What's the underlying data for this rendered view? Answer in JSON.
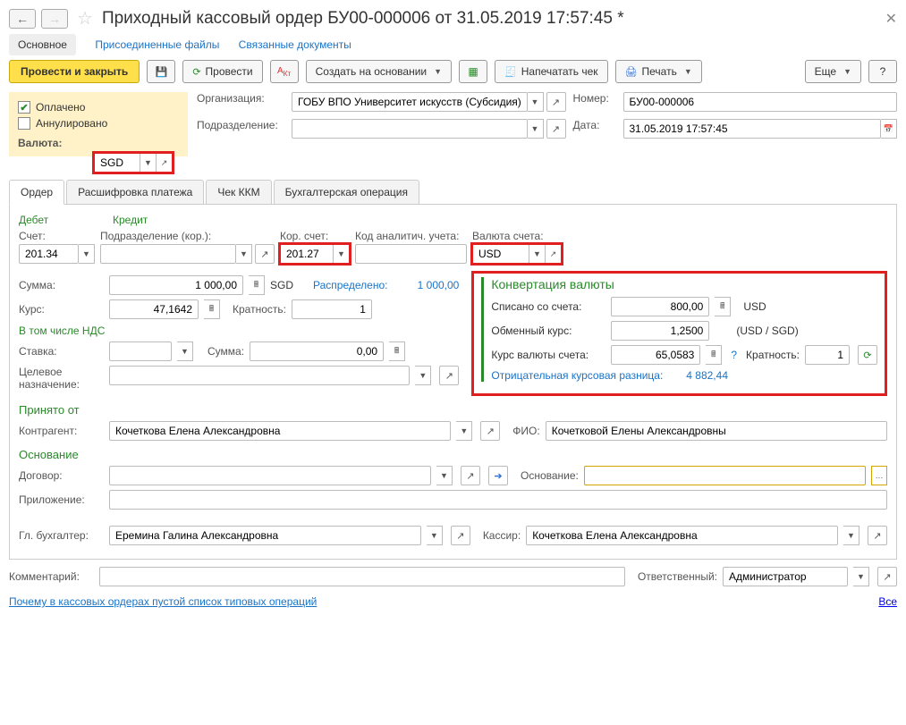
{
  "title": "Приходный кассовый ордер БУ00-000006 от 31.05.2019 17:57:45 *",
  "subnav": {
    "main": "Основное",
    "files": "Присоединенные файлы",
    "linked": "Связанные документы"
  },
  "toolbar": {
    "postClose": "Провести и закрыть",
    "post": "Провести",
    "createBased": "Создать на основании",
    "printReceipt": "Напечатать чек",
    "print": "Печать",
    "more": "Еще",
    "help": "?"
  },
  "status": {
    "paid": "Оплачено",
    "cancelled": "Аннулировано"
  },
  "header": {
    "orgLabel": "Организация:",
    "org": "ГОБУ ВПО Университет искусств (Субсидия)",
    "numLabel": "Номер:",
    "num": "БУ00-000006",
    "depLabel": "Подразделение:",
    "dep": "",
    "dateLabel": "Дата:",
    "date": "31.05.2019 17:57:45",
    "currencyLabel": "Валюта:",
    "currency": "SGD"
  },
  "tabs": {
    "order": "Ордер",
    "decoding": "Расшифровка платежа",
    "kkm": "Чек ККМ",
    "accounting": "Бухгалтерская операция"
  },
  "order": {
    "debitHdr": "Дебет",
    "creditHdr": "Кредит",
    "accountLabel": "Счет:",
    "account": "201.34",
    "corrDeptLabel": "Подразделение (кор.):",
    "corrDept": "",
    "corrAccountLabel": "Кор. счет:",
    "corrAccount": "201.27",
    "analyticLabel": "Код аналитич. учета:",
    "analytic": "",
    "accCurrencyLabel": "Валюта счета:",
    "accCurrency": "USD",
    "sumLabel": "Сумма:",
    "sum": "1 000,00",
    "sumCur": "SGD",
    "allocatedLabel": "Распределено:",
    "allocated": "1 000,00",
    "rateLabel": "Курс:",
    "rate": "47,1642",
    "multLabel": "Кратность:",
    "mult": "1",
    "vatHdr": "В том числе НДС",
    "vatRateLabel": "Ставка:",
    "vatRate": "",
    "vatSumLabel": "Сумма:",
    "vatSum": "0,00",
    "purposeLabel": "Целевое назначение:",
    "purpose": ""
  },
  "conv": {
    "title": "Конвертация валюты",
    "debitedLabel": "Списано со счета:",
    "debited": "800,00",
    "debitedCur": "USD",
    "exRateLabel": "Обменный курс:",
    "exRate": "1,2500",
    "exRatePair": "(USD / SGD)",
    "accRateLabel": "Курс валюты счета:",
    "accRate": "65,0583",
    "multLabel": "Кратность:",
    "mult": "1",
    "diffLabel": "Отрицательная курсовая разница:",
    "diff": "4 882,44"
  },
  "accepted": {
    "title": "Принято от",
    "counterpartyLabel": "Контрагент:",
    "counterparty": "Кочеткова Елена Александровна",
    "fioLabel": "ФИО:",
    "fio": "Кочетковой Елены Александровны"
  },
  "basis": {
    "title": "Основание",
    "contractLabel": "Договор:",
    "contract": "",
    "basisLabel": "Основание:",
    "basis": "",
    "attachmentLabel": "Приложение:",
    "attachment": ""
  },
  "signers": {
    "chiefAccLabel": "Гл. бухгалтер:",
    "chiefAcc": "Еремина Галина Александровна",
    "cashierLabel": "Кассир:",
    "cashier": "Кочеткова Елена Александровна"
  },
  "footer": {
    "commentLabel": "Комментарий:",
    "comment": "",
    "responsibleLabel": "Ответственный:",
    "responsible": "Администратор",
    "whyEmpty": "Почему в кассовых ордерах пустой список типовых операций",
    "all": "Все"
  }
}
